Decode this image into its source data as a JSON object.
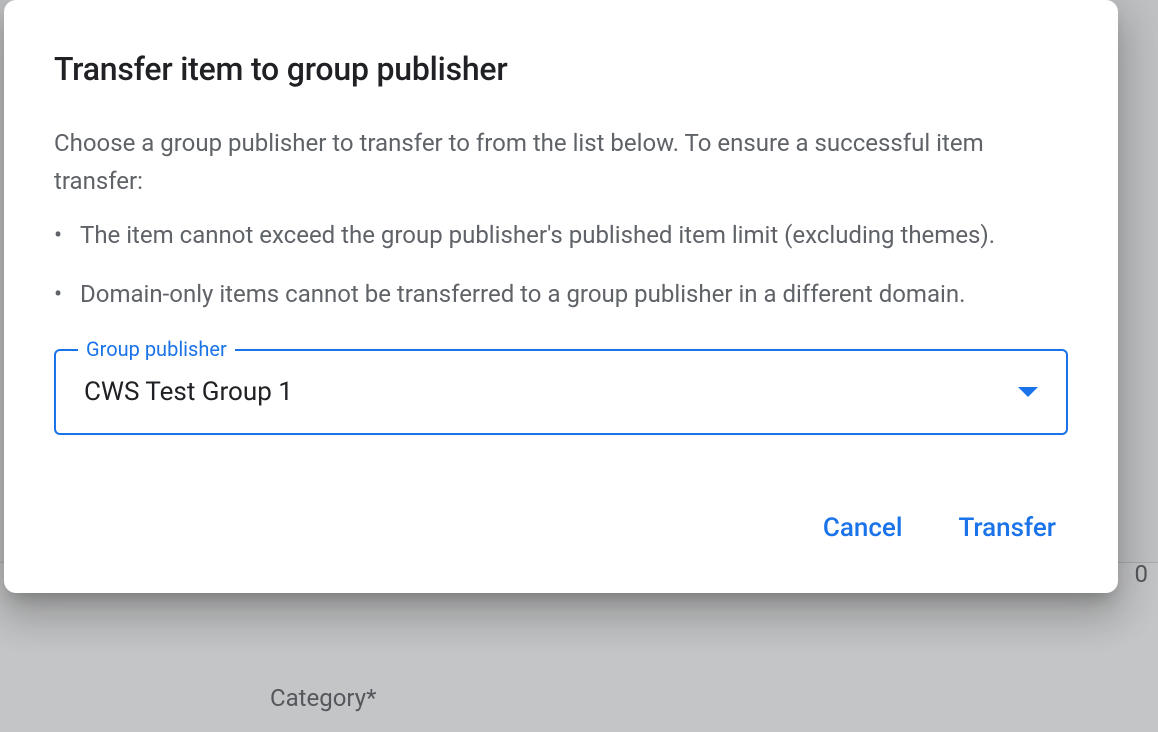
{
  "modal": {
    "title": "Transfer item to group publisher",
    "description": "Choose a group publisher to transfer to from the list below. To ensure a successful item transfer:",
    "requirements": [
      "The item cannot exceed the group publisher's published item limit (excluding themes).",
      "Domain-only items cannot be transferred to a group publisher in a different domain."
    ],
    "select": {
      "label": "Group publisher",
      "value": "CWS Test Group 1"
    },
    "actions": {
      "cancel": "Cancel",
      "transfer": "Transfer"
    }
  },
  "background": {
    "field_label": "Category*",
    "number": "0"
  }
}
